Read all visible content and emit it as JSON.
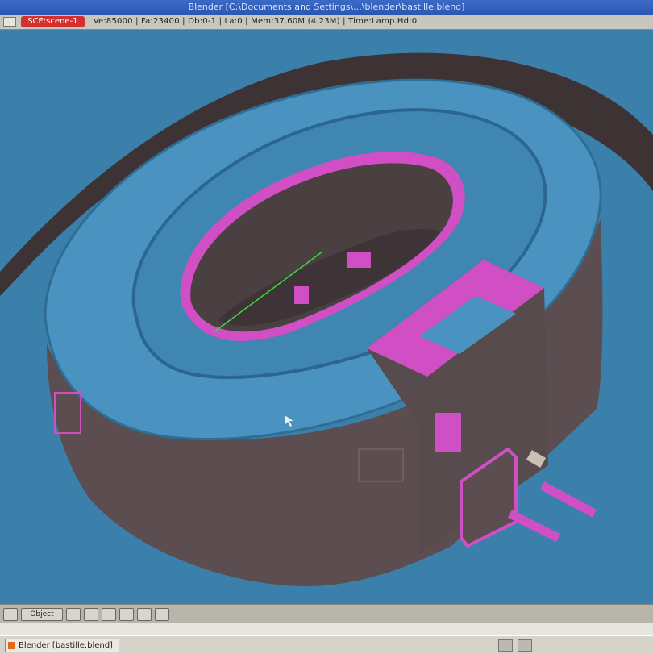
{
  "window": {
    "title": "Blender [C:\\Documents and Settings\\...\\blender\\bastille.blend]",
    "scene_label": "SCE:scene-1",
    "stats": "Ve:85000 | Fa:23400 | Ob:0-1 | La:0 | Mem:37.60M (4.23M) | Time:Lamp.Hd:0"
  },
  "viewport": {
    "background_color": "#3b80aa",
    "model_top_color": "#4a93c0",
    "model_wall_color": "#5b4d50",
    "highlight_color": "#d04fc4"
  },
  "header3d": {
    "mode_label": "Object"
  },
  "taskbar": {
    "task_label": "Blender [bastille.blend]"
  }
}
